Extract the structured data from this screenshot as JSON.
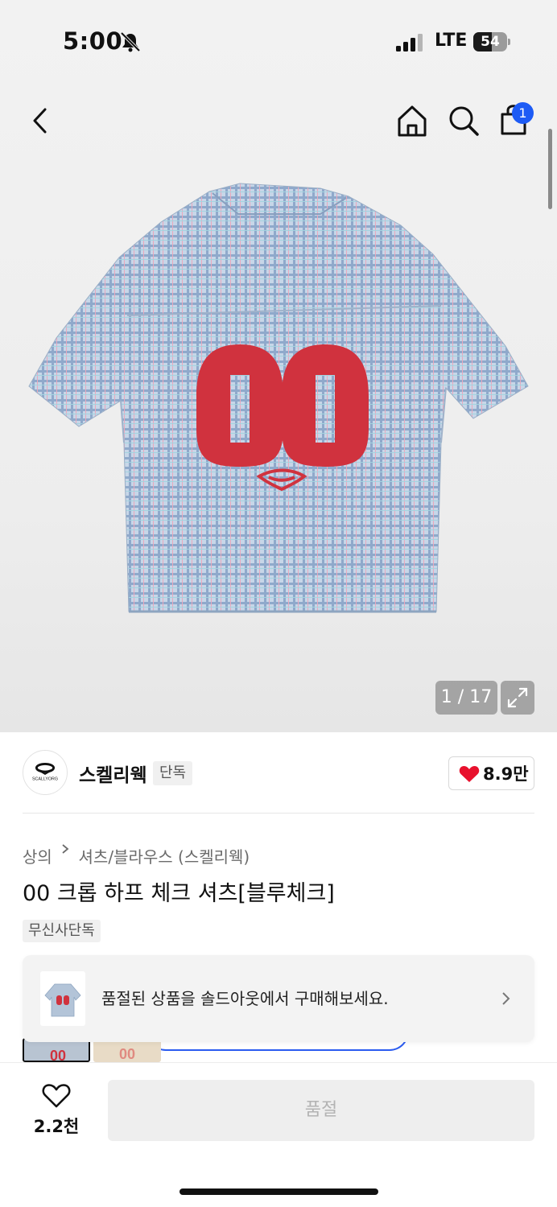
{
  "status_bar": {
    "time": "5:00",
    "network": "LTE",
    "battery_level": "54",
    "battery_fraction": 0.54
  },
  "header": {
    "back_icon": "chevron-left-icon",
    "home_icon": "home-icon",
    "search_icon": "search-icon",
    "cart_icon": "shopping-bag-icon",
    "cart_count": "1"
  },
  "gallery": {
    "counter": "1 / 17",
    "expand_icon": "expand-icon",
    "shirt_number": "00"
  },
  "brand": {
    "name": "스켈리웩",
    "tag": "단독",
    "logo_text": "SCALLYORG",
    "likes": "8.9만"
  },
  "product": {
    "breadcrumb": [
      "상의",
      "셔츠/블라우스 (스켈리웩)"
    ],
    "title": "00 크롭 하프 체크 셔츠[블루체크]",
    "exclusive_badge": "무신사단독"
  },
  "soldout_banner": {
    "text": "품절된 상품을 솔드아웃에서 구매해보세요."
  },
  "bottom_bar": {
    "wish_count": "2.2천",
    "buy_label": "품절"
  },
  "colors": {
    "accent_blue": "#1d5bf5",
    "heart_red": "#e8112d",
    "print_red": "#d0323e",
    "check_blue": "#a9bfd8"
  }
}
